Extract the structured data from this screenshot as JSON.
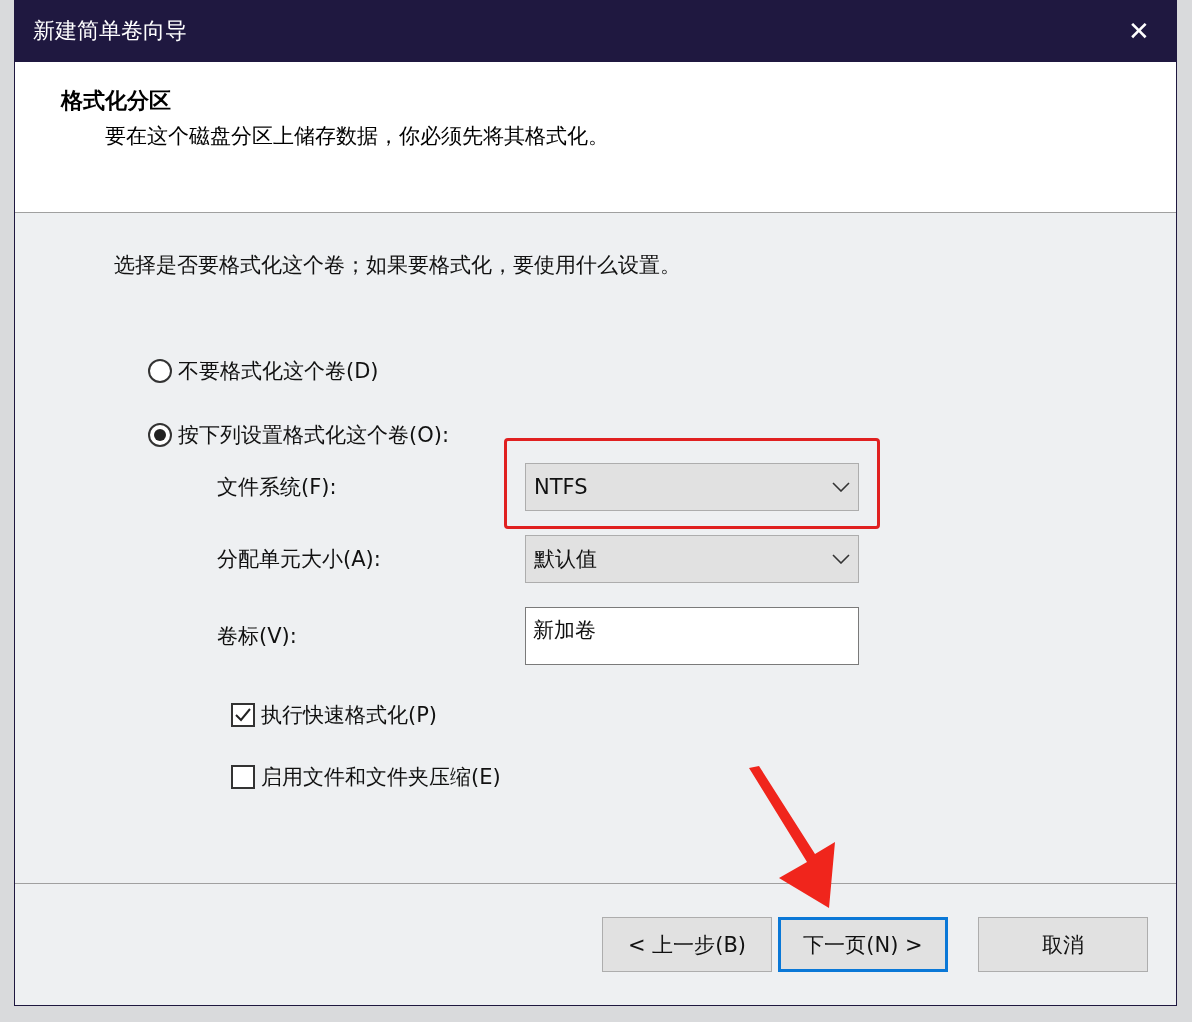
{
  "window": {
    "title": "新建简单卷向导",
    "close": "✕"
  },
  "header": {
    "title": "格式化分区",
    "subtitle": "要在这个磁盘分区上储存数据，你必须先将其格式化。"
  },
  "intro": "选择是否要格式化这个卷；如果要格式化，要使用什么设置。",
  "options": [
    {
      "label": "不要格式化这个卷(D)",
      "selected": false
    },
    {
      "label": "按下列设置格式化这个卷(O):",
      "selected": true
    }
  ],
  "settings": [
    {
      "kind": "dropdown",
      "label": "文件系统(F):",
      "value": "NTFS",
      "highlighted": true
    },
    {
      "kind": "dropdown",
      "label": "分配单元大小(A):",
      "value": "默认值",
      "highlighted": false
    },
    {
      "kind": "text",
      "label": "卷标(V):",
      "value": "新加卷",
      "highlighted": false
    }
  ],
  "checkboxes": [
    {
      "label": "执行快速格式化(P)",
      "checked": true
    },
    {
      "label": "启用文件和文件夹压缩(E)",
      "checked": false
    }
  ],
  "buttons": [
    {
      "label": "< 上一步(B)",
      "focused": false
    },
    {
      "label": "下一页(N) >",
      "focused": true
    },
    {
      "label": "取消",
      "focused": false
    }
  ]
}
